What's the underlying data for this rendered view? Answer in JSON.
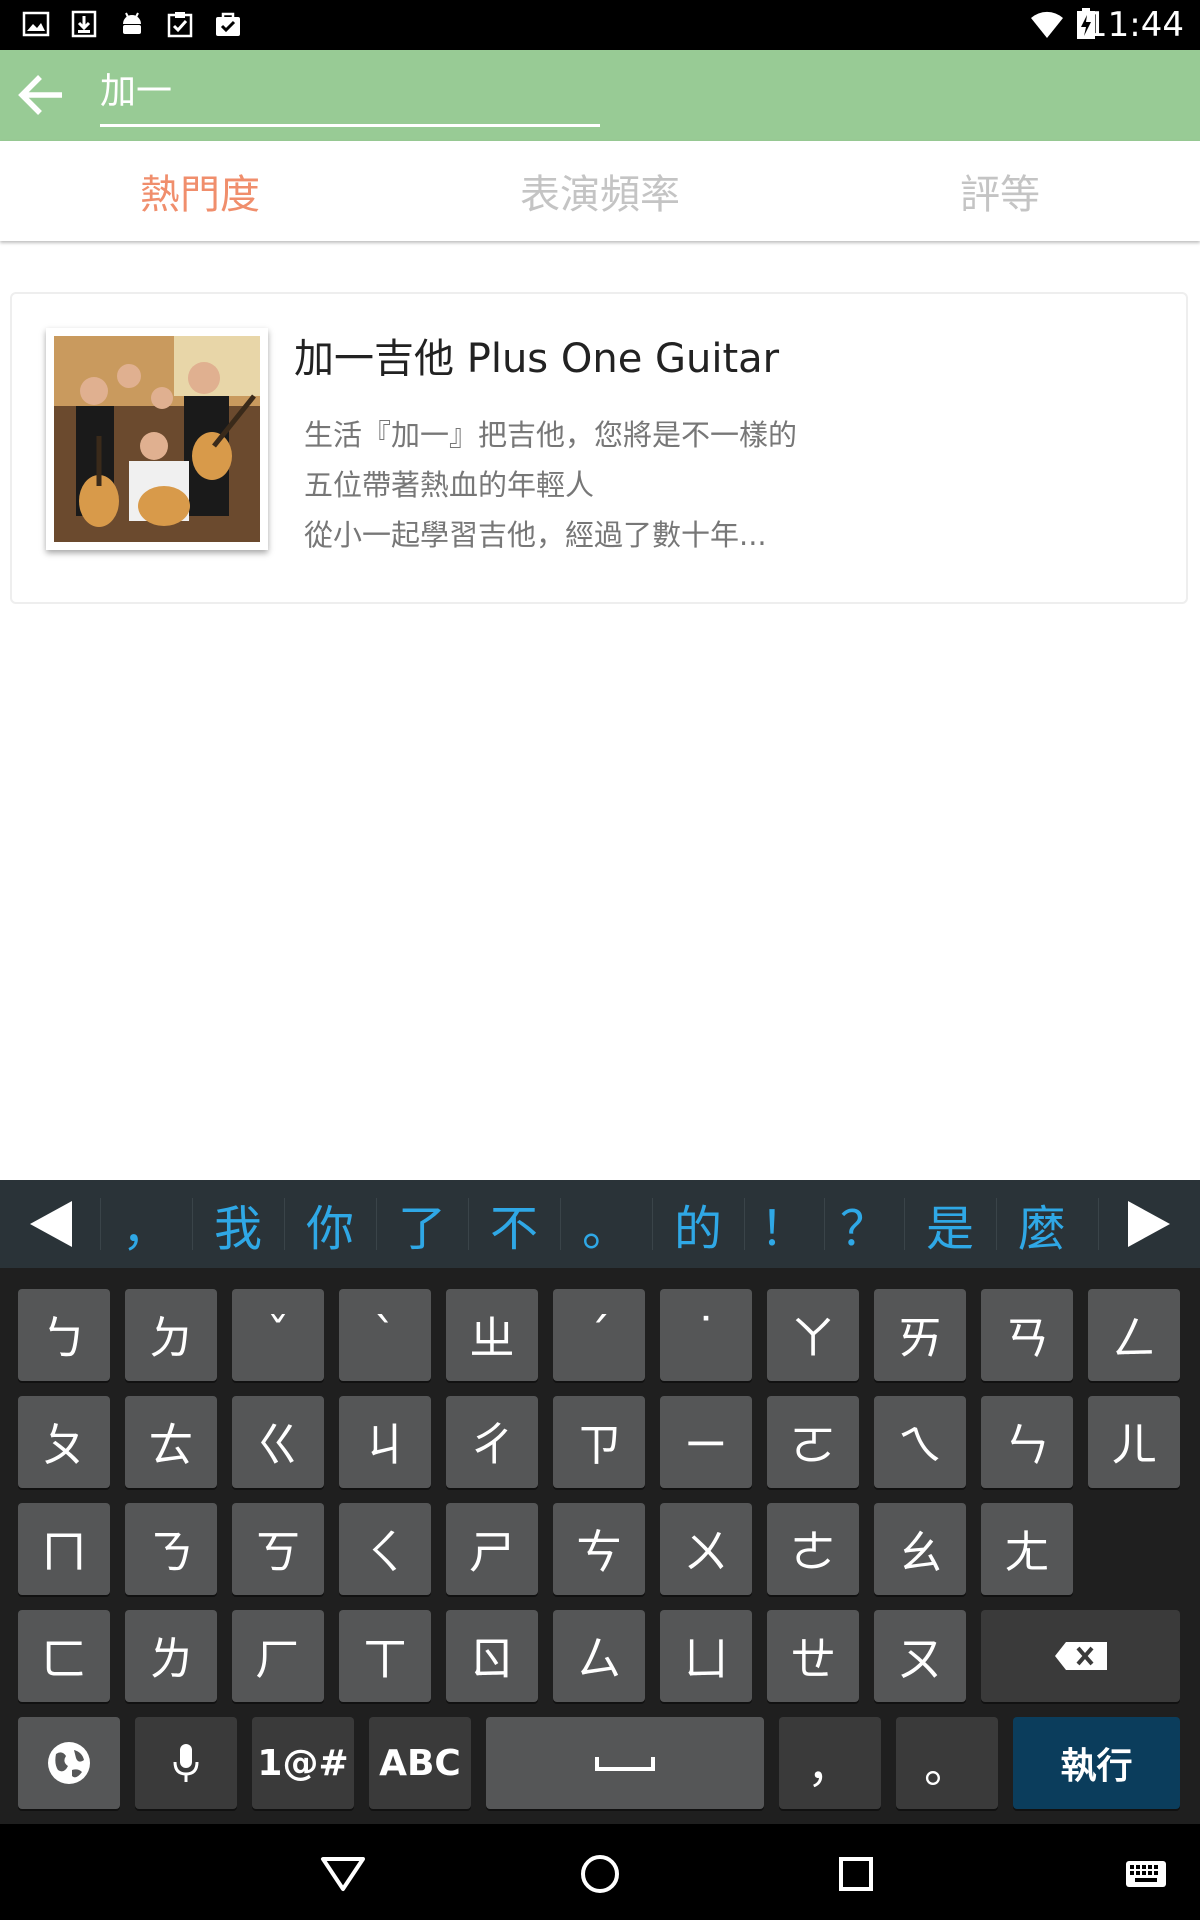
{
  "status_bar": {
    "time": "11:44",
    "left_icons": [
      "image-icon",
      "download-icon",
      "android-icon",
      "clipboard-check-icon",
      "bag-check-icon"
    ],
    "right_icons": [
      "wifi-icon",
      "battery-charging-icon"
    ]
  },
  "app_bar": {
    "search_value": "加一",
    "back_icon": "arrow-left-icon"
  },
  "tabs": [
    {
      "label": "熱門度",
      "active": true
    },
    {
      "label": "表演頻率",
      "active": false
    },
    {
      "label": "評等",
      "active": false
    }
  ],
  "result": {
    "title": "加一吉他 Plus One Guitar",
    "lines": [
      "生活『加一』把吉他，您將是不一樣的",
      "五位帶著熱血的年輕人",
      "從小一起學習吉他，經過了數十年..."
    ]
  },
  "keyboard": {
    "candidates": [
      "，",
      "我",
      "你",
      "了",
      "不",
      "。",
      "的",
      "！",
      "？",
      "是",
      "麼"
    ],
    "rows": [
      [
        "ㄅ",
        "ㄉ",
        "ˇ",
        "ˋ",
        "ㄓ",
        "ˊ",
        "˙",
        "ㄚ",
        "ㄞ",
        "ㄢ",
        "ㄥ"
      ],
      [
        "ㄆ",
        "ㄊ",
        "ㄍ",
        "ㄐ",
        "ㄔ",
        "ㄗ",
        "ㄧ",
        "ㄛ",
        "ㄟ",
        "ㄣ",
        "ㄦ"
      ],
      [
        "ㄇ",
        "ㄋ",
        "ㄎ",
        "ㄑ",
        "ㄕ",
        "ㄘ",
        "ㄨ",
        "ㄜ",
        "ㄠ",
        "ㄤ"
      ],
      [
        "ㄈ",
        "ㄌ",
        "ㄏ",
        "ㄒ",
        "ㄖ",
        "ㄙ",
        "ㄩ",
        "ㄝ",
        "ㄡ"
      ]
    ],
    "bottom": {
      "symbols": "1@#",
      "abc": "ABC",
      "comma": "，",
      "period": "。",
      "enter": "執行"
    },
    "colors": {
      "accent": "#2fa8e6",
      "enter_bg": "#0b3d5c"
    }
  },
  "colors": {
    "app_bar": "#98cb95",
    "tab_active": "#f08e6c",
    "tab_inactive": "#c4c4c4"
  }
}
